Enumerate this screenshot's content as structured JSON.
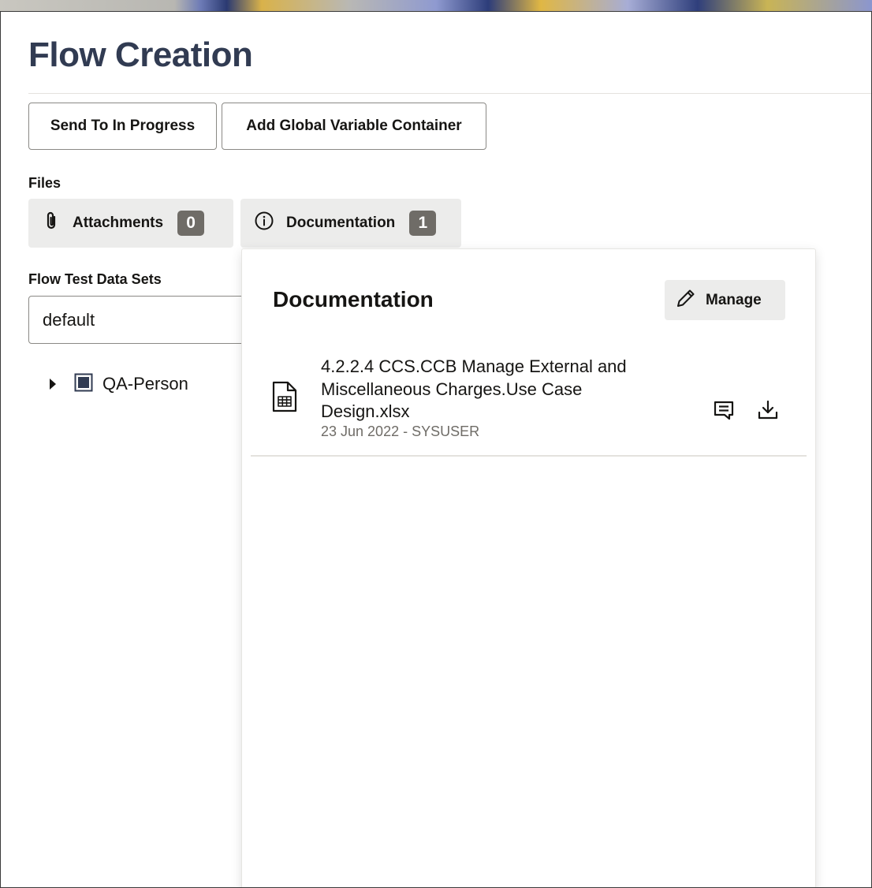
{
  "page": {
    "title": "Flow Creation"
  },
  "toolbar": {
    "send_label": "Send To In Progress",
    "add_label": "Add Global Variable Container"
  },
  "files": {
    "label": "Files",
    "tabs": [
      {
        "label": "Attachments",
        "count": "0",
        "icon": "paperclip-icon"
      },
      {
        "label": "Documentation",
        "count": "1",
        "icon": "info-icon"
      }
    ]
  },
  "test_data_sets": {
    "label": "Flow Test Data Sets",
    "selected": "default",
    "tree": [
      {
        "label": "QA-Person",
        "icon": "grid-icon",
        "expanded": false
      }
    ]
  },
  "documentation_popover": {
    "title": "Documentation",
    "manage_label": "Manage",
    "items": [
      {
        "name": "4.2.2.4 CCS.CCB Manage External and Miscellaneous Charges.Use Case Design.xlsx",
        "meta": "23 Jun 2022 - SYSUSER",
        "icon": "spreadsheet-file-icon"
      }
    ]
  },
  "colors": {
    "title": "#313b52",
    "badge_bg": "#6f6c67",
    "tab_bg": "#ececeb",
    "muted_text": "#6f6c67"
  }
}
